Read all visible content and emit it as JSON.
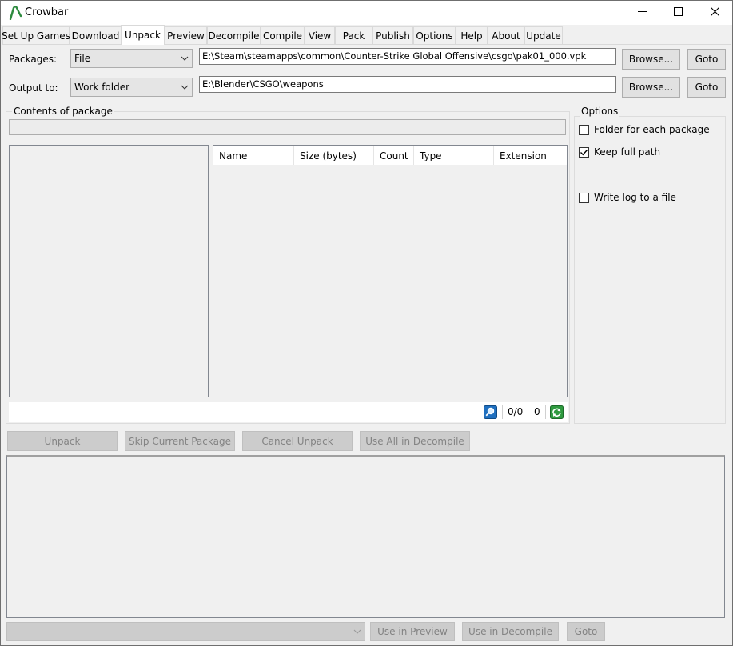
{
  "window": {
    "title": "Crowbar",
    "controls": {
      "minimize": "minimize-icon",
      "maximize": "maximize-icon",
      "close": "close-icon"
    }
  },
  "tabs": [
    {
      "label": "Set Up Games"
    },
    {
      "label": "Download"
    },
    {
      "label": "Unpack",
      "active": true
    },
    {
      "label": "Preview"
    },
    {
      "label": "Decompile"
    },
    {
      "label": "Compile"
    },
    {
      "label": "View"
    },
    {
      "label": "Pack"
    },
    {
      "label": "Publish"
    },
    {
      "label": "Options"
    },
    {
      "label": "Help"
    },
    {
      "label": "About"
    },
    {
      "label": "Update"
    }
  ],
  "unpack": {
    "packages": {
      "label": "Packages:",
      "mode": "File",
      "path": "E:\\Steam\\steamapps\\common\\Counter-Strike Global Offensive\\csgo\\pak01_000.vpk",
      "browse": "Browse...",
      "goto": "Goto"
    },
    "output": {
      "label": "Output to:",
      "mode": "Work folder",
      "path": "E:\\Blender\\CSGO\\weapons",
      "browse": "Browse...",
      "goto": "Goto"
    },
    "contents": {
      "title": "Contents of package",
      "path_value": "",
      "columns": [
        "Name",
        "Size (bytes)",
        "Count",
        "Type",
        "Extension"
      ],
      "rows": [],
      "status_count": "0/0",
      "status_size": "0"
    },
    "options": {
      "title": "Options",
      "folder_each": {
        "label": "Folder for each package",
        "checked": false
      },
      "keep_path": {
        "label": "Keep full path",
        "checked": true
      },
      "write_log": {
        "label": "Write log to a file",
        "checked": false
      }
    },
    "actions": {
      "unpack": "Unpack",
      "skip": "Skip Current Package",
      "cancel": "Cancel Unpack",
      "use_all": "Use All in Decompile"
    },
    "log": {
      "text": ""
    },
    "bottom": {
      "selected_output": "",
      "use_preview": "Use in Preview",
      "use_decompile": "Use in Decompile",
      "goto": "Goto"
    }
  },
  "colors": {
    "window_bg": "#f0f0f0",
    "accent_logo": "#2d8a3e",
    "status_search": "#1f6fbf",
    "status_refresh": "#2e9a3f"
  }
}
